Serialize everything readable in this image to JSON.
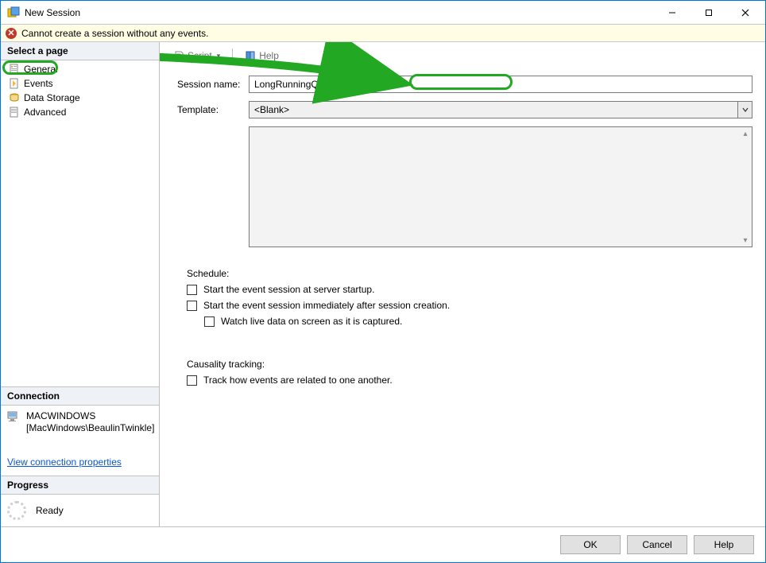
{
  "titlebar": {
    "title": "New Session"
  },
  "message_bar": {
    "text": "Cannot create a session without any events."
  },
  "nav": {
    "select_page": "Select a page",
    "items": [
      "General",
      "Events",
      "Data Storage",
      "Advanced"
    ],
    "connection_title": "Connection",
    "server": "MACWINDOWS",
    "user": "[MacWindows\\BeaulinTwinkle]",
    "view_props": "View connection properties",
    "progress_title": "Progress",
    "progress_status": "Ready"
  },
  "toolbar": {
    "script": "Script",
    "help": "Help"
  },
  "form": {
    "session_name_label": "Session name:",
    "session_name_value": "LongRunningQuery",
    "template_label": "Template:",
    "template_value": "<Blank>"
  },
  "schedule": {
    "title": "Schedule:",
    "opt1": "Start the event session at server startup.",
    "opt2": "Start the event session immediately after session creation.",
    "opt3": "Watch live data on screen as it is captured."
  },
  "causality": {
    "title": "Causality tracking:",
    "opt1": "Track how events are related to one another."
  },
  "footer": {
    "ok": "OK",
    "cancel": "Cancel",
    "help": "Help"
  }
}
